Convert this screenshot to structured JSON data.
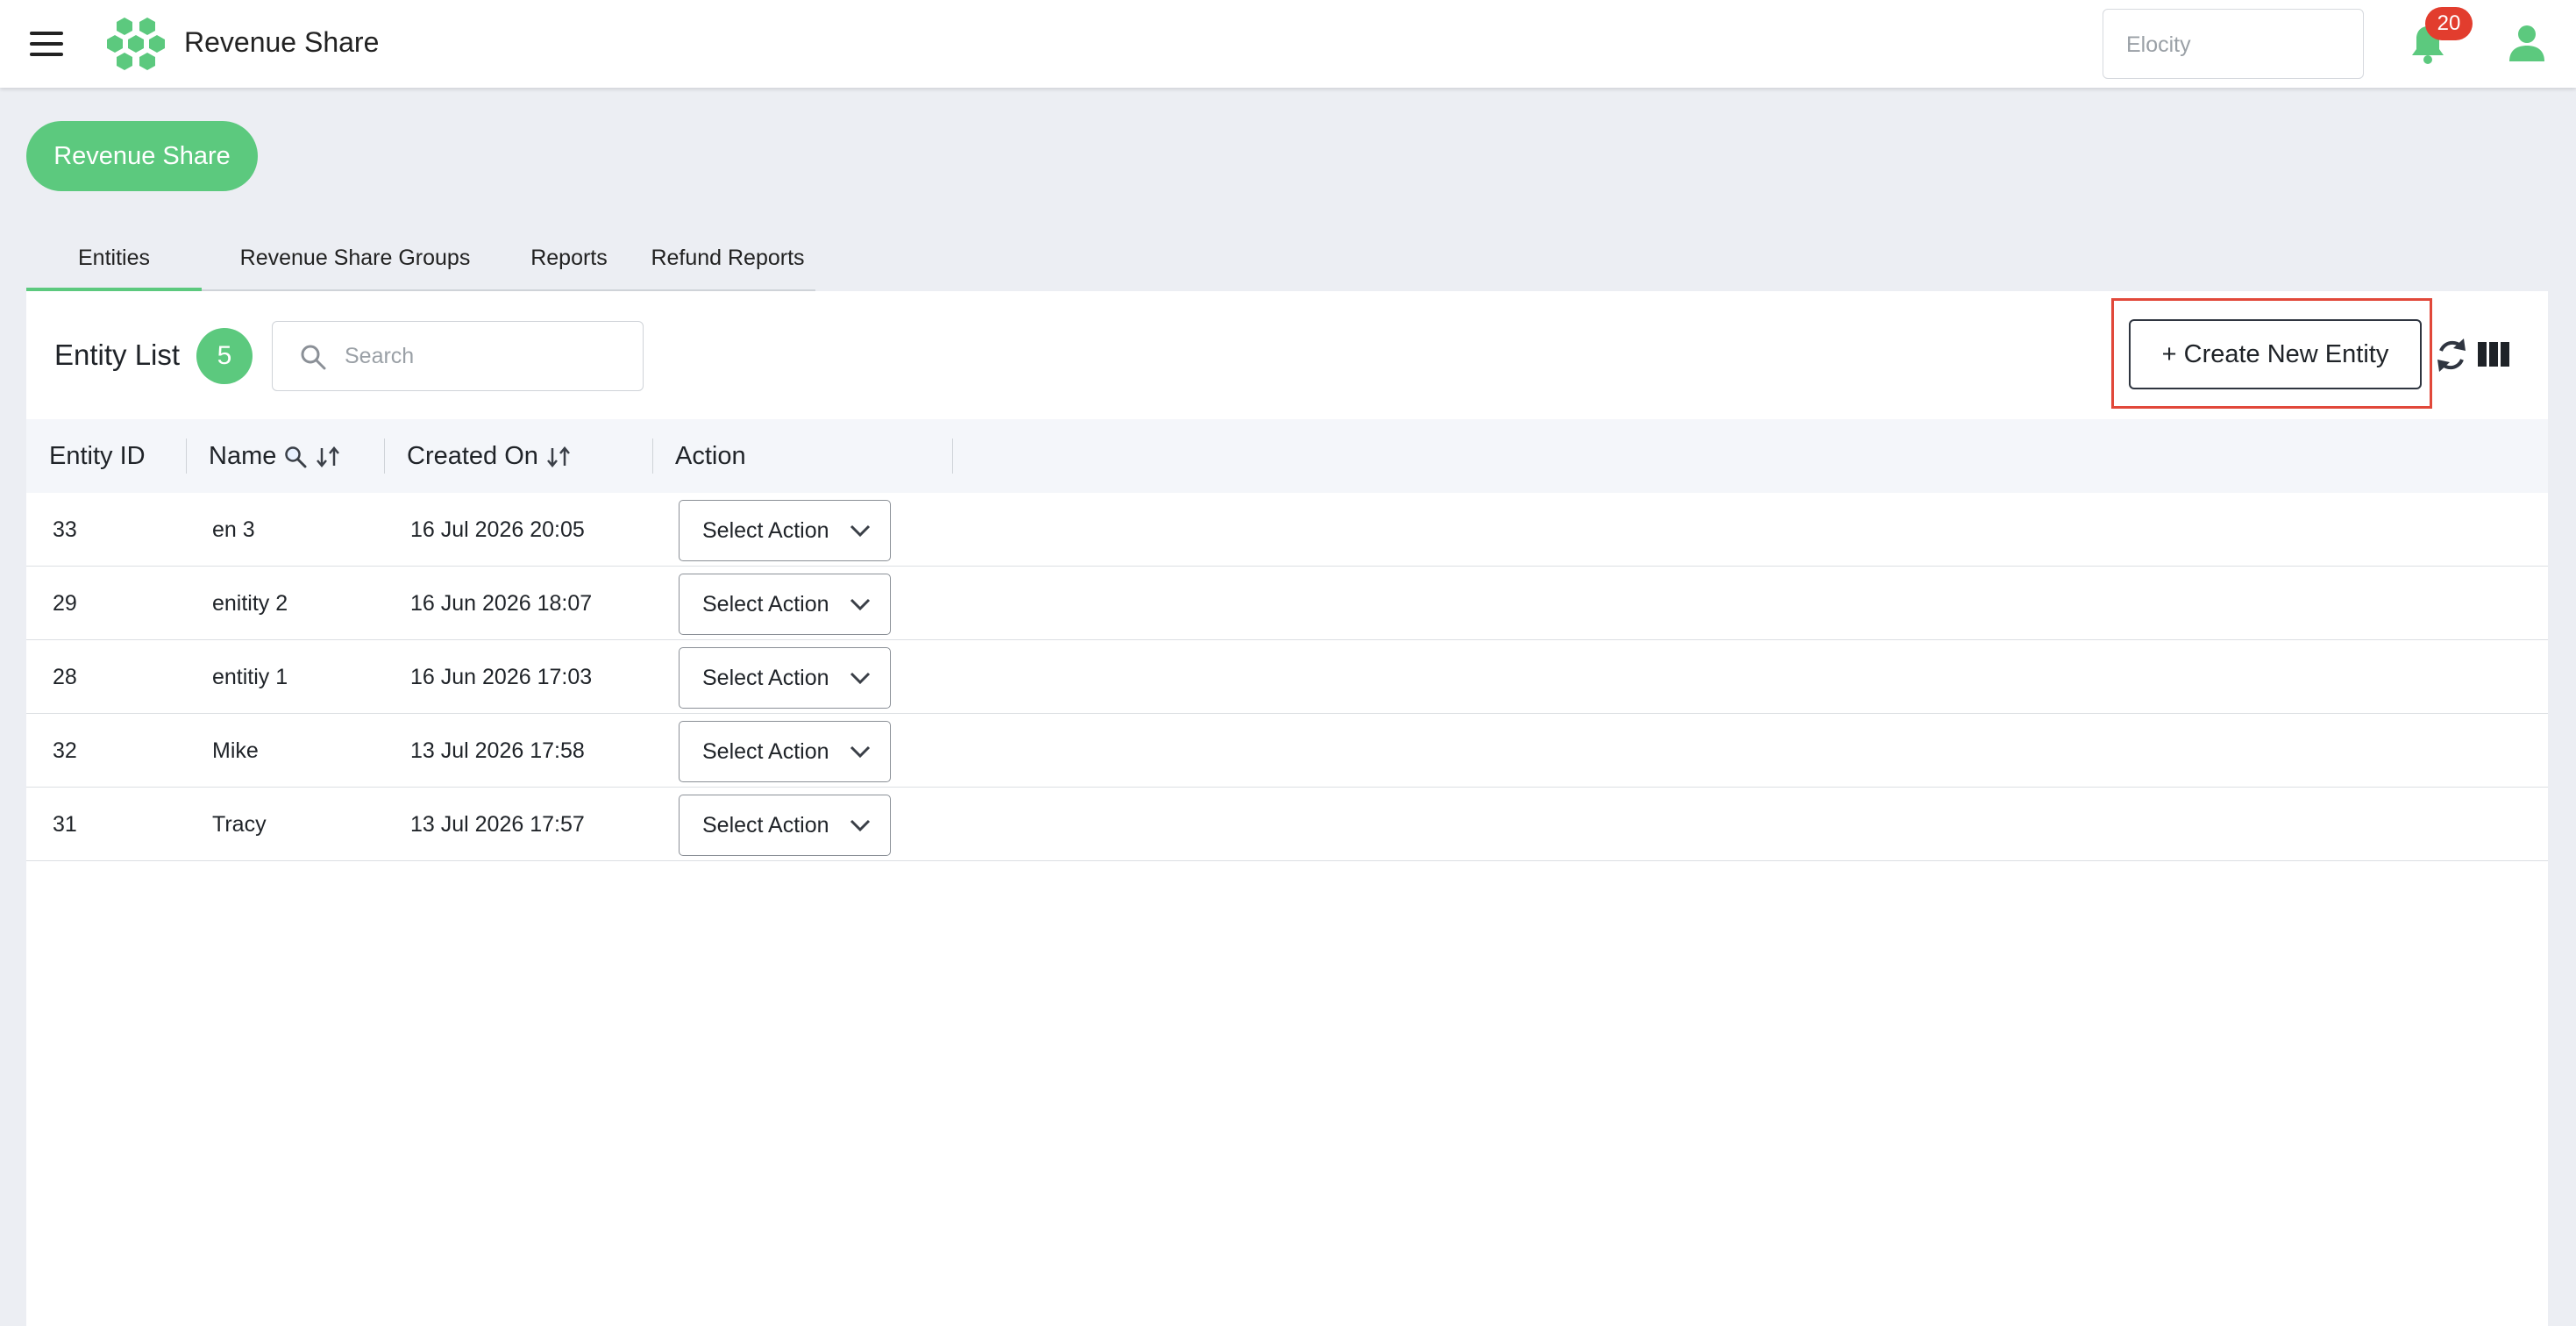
{
  "header": {
    "app_title": "Revenue Share",
    "org_selector_value": "Elocity",
    "notification_count": "20"
  },
  "page": {
    "pill_label": "Revenue Share"
  },
  "tabs": [
    {
      "label": "Entities",
      "active": true
    },
    {
      "label": "Revenue Share Groups",
      "active": false
    },
    {
      "label": "Reports",
      "active": false
    },
    {
      "label": "Refund Reports",
      "active": false
    }
  ],
  "entity_list": {
    "title": "Entity List",
    "count": "5",
    "search_placeholder": "Search",
    "create_button_label": "+ Create New Entity"
  },
  "table": {
    "columns": [
      "Entity ID",
      "Name",
      "Created On",
      "Action"
    ],
    "rows": [
      {
        "id": "33",
        "name": "en 3",
        "created": "16 Jul 2026 20:05",
        "action": "Select Action"
      },
      {
        "id": "29",
        "name": "enitity 2",
        "created": "16 Jun 2026 18:07",
        "action": "Select Action"
      },
      {
        "id": "28",
        "name": "entitiy 1",
        "created": "16 Jun 2026 17:03",
        "action": "Select Action"
      },
      {
        "id": "32",
        "name": "Mike",
        "created": "13 Jul 2026 17:58",
        "action": "Select Action"
      },
      {
        "id": "31",
        "name": "Tracy",
        "created": "13 Jul 2026 17:57",
        "action": "Select Action"
      }
    ]
  },
  "colors": {
    "brand_green": "#5cc97e",
    "badge_red": "#e23d2e",
    "highlight_red": "#e1483a"
  },
  "icons": [
    "menu-icon",
    "logo-icon",
    "bell-icon",
    "user-icon",
    "search-icon",
    "sort-icon",
    "refresh-icon",
    "columns-icon",
    "chevron-down-icon"
  ]
}
